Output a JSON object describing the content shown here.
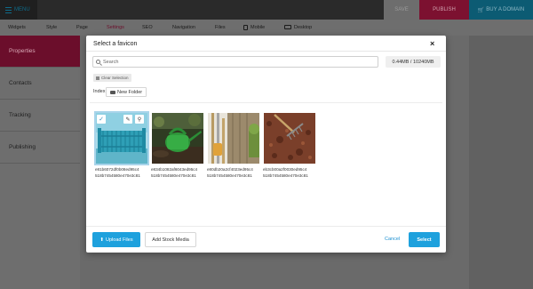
{
  "app": {
    "menu_label": "MENU",
    "save_label": "SAVE",
    "publish_label": "PUBLISH",
    "buy_domain_label": "BUY A DOMAIN",
    "tabs": [
      "Widgets",
      "Style",
      "Page",
      "Settings",
      "SEO",
      "Navigation",
      "Files",
      "Mobile",
      "Desktop"
    ],
    "active_tab": "Settings"
  },
  "sidebar": {
    "items": [
      "Properties",
      "Contacts",
      "Tracking",
      "Publishing"
    ],
    "active": "Properties"
  },
  "modal": {
    "title": "Select a favicon",
    "search_placeholder": "Search",
    "storage": "0.44MB / 10240MB",
    "clear_selection": "Clear Selection",
    "index_label": "Index",
    "new_folder": "New Folder",
    "files": [
      {
        "name_line1": "e81b6072df0b08ed95c4",
        "name_line2": "518b7454580e470e3c81",
        "selected": true
      },
      {
        "name_line1": "e834b1082af6043ed95c4",
        "name_line2": "518b7454580e470e3c81",
        "selected": false
      },
      {
        "name_line1": "e80db20a2cf4023ed95c4",
        "name_line2": "518b7454580e470e3c81",
        "selected": false
      },
      {
        "name_line1": "eb3cb00a2f0030ed95c4",
        "name_line2": "518b7454580e470e3c81",
        "selected": false
      }
    ],
    "upload_label": "Upload Files",
    "stock_label": "Add Stock Media",
    "cancel_label": "Cancel",
    "select_label": "Select"
  },
  "colors": {
    "accent": "#1ea1dd",
    "brand": "#6b0e2b",
    "buy": "#0c5b73"
  }
}
